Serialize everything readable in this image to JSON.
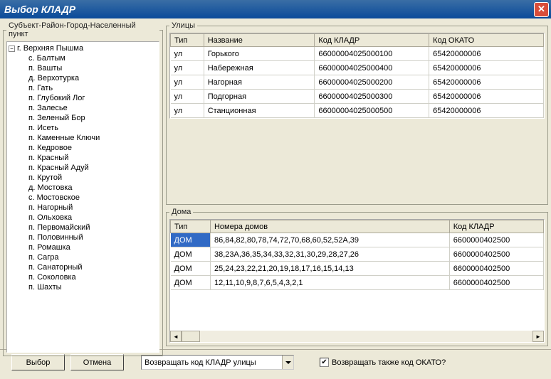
{
  "window": {
    "title": "Выбор КЛАДР"
  },
  "tree": {
    "legend": "Субъект-Район-Город-Населенный пункт",
    "root": "г. Верхняя Пышма",
    "items": [
      "с. Балтым",
      "п. Вашты",
      "д. Верхотурка",
      "п. Гать",
      "п. Глубокий Лог",
      "п. Залесье",
      "п. Зеленый Бор",
      "п. Исеть",
      "п. Каменные Ключи",
      "п. Кедровое",
      "п. Красный",
      "п. Красный Адуй",
      "п. Крутой",
      "д. Мостовка",
      "с. Мостовское",
      "п. Нагорный",
      "п. Ольховка",
      "п. Первомайский",
      "п. Половинный",
      "п. Ромашка",
      "п. Сагра",
      "п. Санаторный",
      "п. Соколовка",
      "п. Шахты"
    ]
  },
  "streets": {
    "legend": "Улицы",
    "headers": {
      "type": "Тип",
      "name": "Название",
      "kladr": "Код КЛАДР",
      "okato": "Код ОКАТО"
    },
    "rows": [
      {
        "type": "ул",
        "name": "Горького",
        "kladr": "66000004025000100",
        "okato": "65420000006"
      },
      {
        "type": "ул",
        "name": "Набережная",
        "kladr": "66000004025000400",
        "okato": "65420000006"
      },
      {
        "type": "ул",
        "name": "Нагорная",
        "kladr": "66000004025000200",
        "okato": "65420000006"
      },
      {
        "type": "ул",
        "name": "Подгорная",
        "kladr": "66000004025000300",
        "okato": "65420000006"
      },
      {
        "type": "ул",
        "name": "Станционная",
        "kladr": "66000004025000500",
        "okato": "65420000006"
      }
    ]
  },
  "houses": {
    "legend": "Дома",
    "headers": {
      "type": "Тип",
      "numbers": "Номера домов",
      "kladr": "Код КЛАДР"
    },
    "rows": [
      {
        "type": "ДОМ",
        "numbers": "86,84,82,80,78,74,72,70,68,60,52,52А,39",
        "kladr": "6600000402500"
      },
      {
        "type": "ДОМ",
        "numbers": "38,23А,36,35,34,33,32,31,30,29,28,27,26",
        "kladr": "6600000402500"
      },
      {
        "type": "ДОМ",
        "numbers": "25,24,23,22,21,20,19,18,17,16,15,14,13",
        "kladr": "6600000402500"
      },
      {
        "type": "ДОМ",
        "numbers": "12,11,10,9,8,7,6,5,4,3,2,1",
        "kladr": "6600000402500"
      }
    ]
  },
  "footer": {
    "select": "Выбор",
    "cancel": "Отмена",
    "combo": "Возвращать код КЛАДР улицы",
    "checkbox_label": "Возвращать также код ОКАТО?",
    "checkbox_checked": true
  }
}
